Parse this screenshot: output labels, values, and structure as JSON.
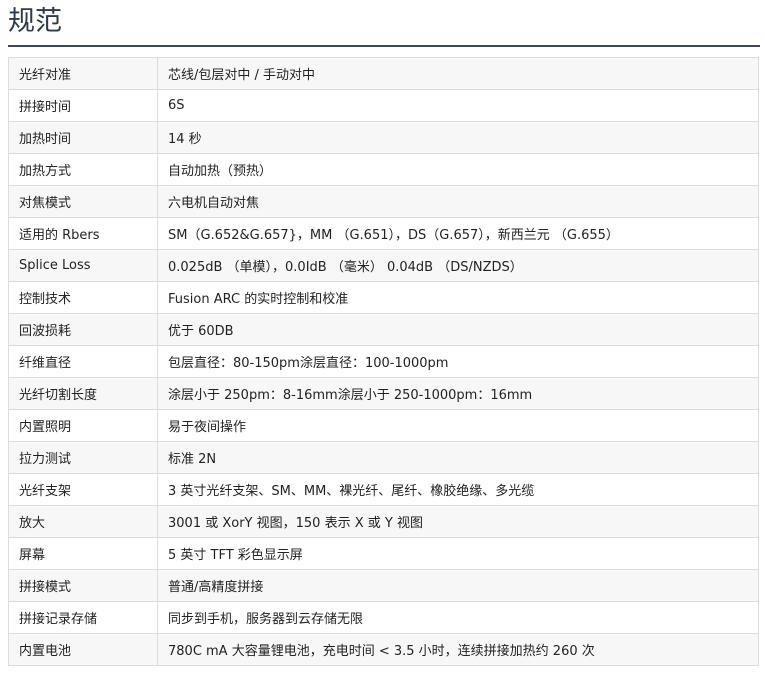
{
  "page": {
    "title": "规范"
  },
  "spec_table": {
    "rows": [
      {
        "key": "光纤对准",
        "value": "芯线/包层对中 / 手动对中"
      },
      {
        "key": "拼接时间",
        "value": "6S"
      },
      {
        "key": "加热时间",
        "value": "14 秒"
      },
      {
        "key": "加热方式",
        "value": "自动加热（预热）"
      },
      {
        "key": "对焦模式",
        "value": "六电机自动对焦"
      },
      {
        "key": "适用的 Rbers",
        "value": "SM（G.652&G.657}，MM （G.651），DS（G.657），新西兰元 （G.655）"
      },
      {
        "key": "Splice Loss",
        "value": "0.025dB （单模），0.0IdB （毫米） 0.04dB （DS/NZDS）"
      },
      {
        "key": "控制技术",
        "value": "Fusion ARC 的实时控制和校准"
      },
      {
        "key": "回波损耗",
        "value": "优于 60DB"
      },
      {
        "key": "纤维直径",
        "value": "包层直径：80-150pm涂层直径：100-1000pm"
      },
      {
        "key": "光纤切割长度",
        "value": "涂层小于 250pm：8-16mm涂层小于 250-1000pm：16mm"
      },
      {
        "key": "内置照明",
        "value": "易于夜间操作"
      },
      {
        "key": "拉力测试",
        "value": "标准 2N"
      },
      {
        "key": "光纤支架",
        "value": "3 英寸光纤支架、SM、MM、裸光纤、尾纤、橡胶绝缘、多光缆"
      },
      {
        "key": "放大",
        "value": "3001 或 XorY 视图，150 表示 X 或 Y 视图"
      },
      {
        "key": "屏幕",
        "value": "5 英寸 TFT 彩色显示屏"
      },
      {
        "key": "拼接模式",
        "value": "普通/高精度拼接"
      },
      {
        "key": "拼接记录存储",
        "value": "同步到手机，服务器到云存储无限"
      },
      {
        "key": "内置电池",
        "value": "780C mA 大容量锂电池，充电时间 < 3.5 小时，连续拼接加热约 260 次"
      }
    ]
  }
}
